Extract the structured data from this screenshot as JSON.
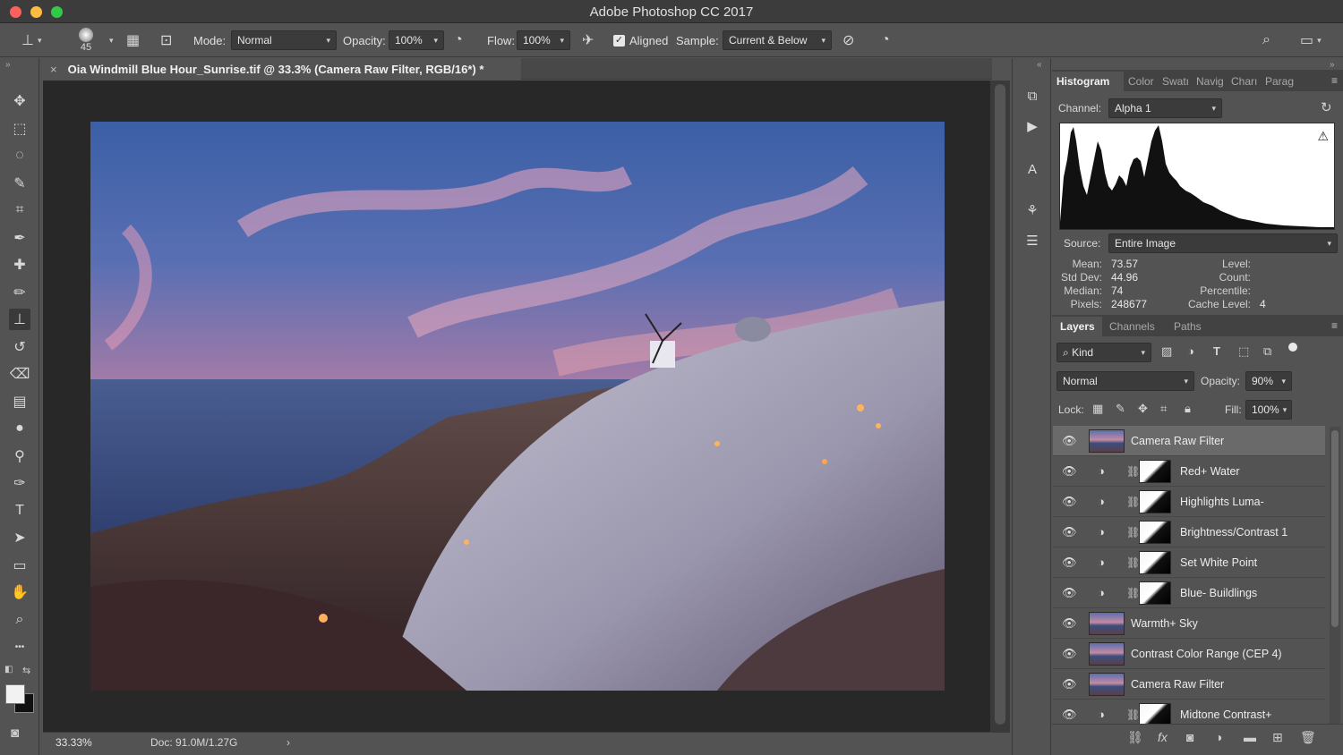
{
  "window": {
    "title": "Adobe Photoshop CC 2017"
  },
  "options_bar": {
    "brush_size": "45",
    "mode_label": "Mode:",
    "mode_value": "Normal",
    "opacity_label": "Opacity:",
    "opacity_value": "100%",
    "flow_label": "Flow:",
    "flow_value": "100%",
    "aligned_label": "Aligned",
    "aligned_checked": true,
    "sample_label": "Sample:",
    "sample_value": "Current & Below"
  },
  "document": {
    "tab_title": "Oia Windmill Blue Hour_Sunrise.tif @ 33.3% (Camera Raw Filter, RGB/16*) *",
    "zoom": "33.33%",
    "doc_size": "Doc: 91.0M/1.27G"
  },
  "histogram_panel": {
    "tabs": [
      "Histogram",
      "Color",
      "Swatches",
      "Navigator",
      "Character",
      "Paragraph"
    ],
    "tab_display": [
      "Histogram",
      "Color",
      "Swatı",
      "Navig",
      "Charı",
      "Parag"
    ],
    "channel_label": "Channel:",
    "channel_value": "Alpha 1",
    "source_label": "Source:",
    "source_value": "Entire Image",
    "stats": {
      "mean_label": "Mean:",
      "mean": "73.57",
      "stddev_label": "Std Dev:",
      "stddev": "44.96",
      "median_label": "Median:",
      "median": "74",
      "pixels_label": "Pixels:",
      "pixels": "248677",
      "level_label": "Level:",
      "count_label": "Count:",
      "percentile_label": "Percentile:",
      "cache_label": "Cache Level:",
      "cache": "4"
    }
  },
  "layers_panel": {
    "tabs": [
      "Layers",
      "Channels",
      "Paths"
    ],
    "filter_kind": "Kind",
    "blend_mode": "Normal",
    "opacity_label": "Opacity:",
    "opacity_value": "90%",
    "lock_label": "Lock:",
    "fill_label": "Fill:",
    "fill_value": "100%",
    "layers": [
      {
        "name": "Camera Raw Filter",
        "type": "image",
        "selected": true
      },
      {
        "name": "Red+ Water",
        "type": "adjustment"
      },
      {
        "name": "Highlights Luma-",
        "type": "adjustment"
      },
      {
        "name": "Brightness/Contrast 1",
        "type": "adjustment"
      },
      {
        "name": "Set White Point",
        "type": "adjustment"
      },
      {
        "name": "Blue- Buildlings",
        "type": "adjustment"
      },
      {
        "name": "Warmth+ Sky",
        "type": "image"
      },
      {
        "name": "Contrast Color Range (CEP 4)",
        "type": "image"
      },
      {
        "name": "Camera Raw Filter",
        "type": "image"
      },
      {
        "name": "Midtone Contrast+",
        "type": "adjustment"
      }
    ]
  },
  "tools": [
    {
      "name": "move-tool",
      "glyph": "✥"
    },
    {
      "name": "marquee-tool",
      "glyph": "⬚"
    },
    {
      "name": "lasso-tool",
      "glyph": "◌"
    },
    {
      "name": "quick-selection-tool",
      "glyph": "✎"
    },
    {
      "name": "crop-tool",
      "glyph": "⌗"
    },
    {
      "name": "eyedropper-tool",
      "glyph": "✒"
    },
    {
      "name": "healing-brush-tool",
      "glyph": "✚"
    },
    {
      "name": "brush-tool",
      "glyph": "✏"
    },
    {
      "name": "clone-stamp-tool",
      "glyph": "⊥"
    },
    {
      "name": "history-brush-tool",
      "glyph": "↺"
    },
    {
      "name": "eraser-tool",
      "glyph": "⌫"
    },
    {
      "name": "gradient-tool",
      "glyph": "▤"
    },
    {
      "name": "blur-tool",
      "glyph": "●"
    },
    {
      "name": "dodge-tool",
      "glyph": "⚲"
    },
    {
      "name": "pen-tool",
      "glyph": "✑"
    },
    {
      "name": "type-tool",
      "glyph": "T"
    },
    {
      "name": "path-selection-tool",
      "glyph": "➤"
    },
    {
      "name": "rectangle-tool",
      "glyph": "▭"
    },
    {
      "name": "hand-tool",
      "glyph": "✋"
    },
    {
      "name": "zoom-tool",
      "glyph": "⌕"
    },
    {
      "name": "more-tools",
      "glyph": "•••"
    }
  ],
  "colors": {
    "panel_bg": "#535353",
    "canvas_bg": "#282828",
    "selected_layer": "#6a6a6a"
  }
}
